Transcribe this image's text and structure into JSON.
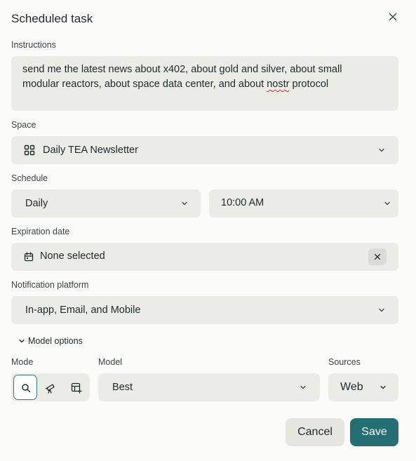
{
  "dialog": {
    "title": "Scheduled task"
  },
  "instructions": {
    "label": "Instructions",
    "line1": "send me the latest news about x402, about gold and silver, about small",
    "line2_before": "modular reactors, about space data center, and about ",
    "line2_misspelled": "nostr",
    "line2_after": " protocol"
  },
  "space": {
    "label": "Space",
    "value": "Daily TEA Newsletter",
    "icon": "grid-icon"
  },
  "schedule": {
    "label": "Schedule",
    "frequency": "Daily",
    "time": "10:00 AM"
  },
  "expiration": {
    "label": "Expiration date",
    "value": "None selected",
    "icon": "calendar-icon"
  },
  "notification": {
    "label": "Notification platform",
    "value": "In-app, Email, and Mobile"
  },
  "model_options": {
    "toggle_label": "Model options",
    "mode_label": "Mode",
    "model_label": "Model",
    "model_value": "Best",
    "sources_label": "Sources",
    "sources_value": "Web",
    "modes": [
      "search-icon",
      "telescope-icon",
      "table-plus-icon"
    ],
    "active_mode": "search-icon"
  },
  "actions": {
    "cancel": "Cancel",
    "save": "Save"
  },
  "colors": {
    "accent": "#236f73",
    "field_bg": "#ecece7",
    "page_bg": "#fbfbf9"
  }
}
